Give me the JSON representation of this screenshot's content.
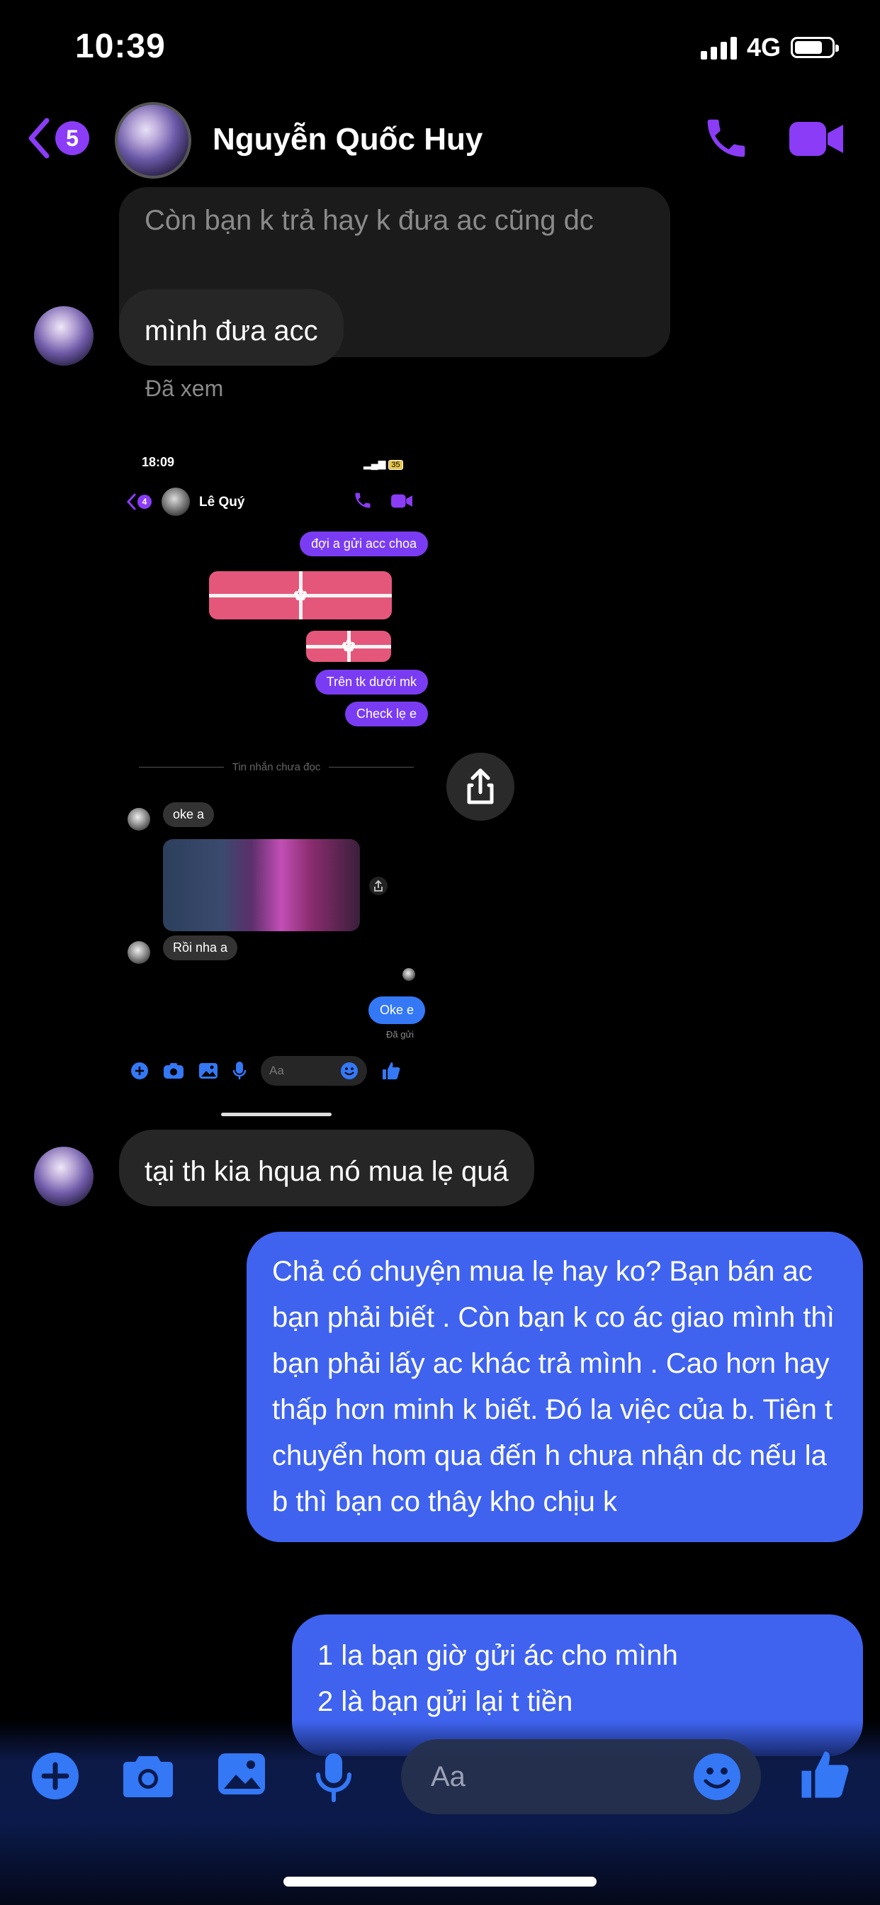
{
  "status_bar": {
    "time": "10:39",
    "network": "4G"
  },
  "header": {
    "back_badge": "5",
    "contact_name": "Nguyễn Quốc Huy"
  },
  "messages": {
    "quoted_reply": "Còn bạn k trả hay k đưa ac cũng dc",
    "minh_dua_acc": "mình đưa acc",
    "seen_label": "Đã xem",
    "tai_th_kia": "tại th kia hqua nó mua lẹ quá",
    "outgoing_1": "Chả có chuyện mua lẹ hay ko? Bạn bán ac bạn phải biết . Còn bạn k co ác giao mình thì bạn phải lấy ac khác trả mình . Cao hơn hay thấp hơn minh k biết. Đó la việc của b. Tiên t chuyển hom qua đến h chưa nhận dc nếu la b thì bạn co thây kho chịu k",
    "outgoing_2_line1": "1 la bạn giờ gửi ác cho mình",
    "outgoing_2_line2": "2 là bạn gửi lại t tiền"
  },
  "embedded_screenshot": {
    "time": "18:09",
    "battery": "35",
    "back_badge": "4",
    "contact_name": "Lê Quý",
    "msg_doi": "đợi a gửi acc choa",
    "msg_tren": "Trên tk dưới mk",
    "msg_check": "Check lẹ e",
    "unread_divider": "Tin nhắn chưa đọc",
    "msg_oke_a": "oke a",
    "msg_roi": "Rồi nha a",
    "msg_oke_e": "Oke e",
    "sent_label": "Đã gửi",
    "input_placeholder": "Aa"
  },
  "composer": {
    "placeholder": "Aa"
  },
  "colors": {
    "accent_purple": "#8b3cf7",
    "outgoing_blue": "#3f63ee",
    "toolbar_blue": "#3478f6",
    "gift_pink": "#e4577b"
  }
}
